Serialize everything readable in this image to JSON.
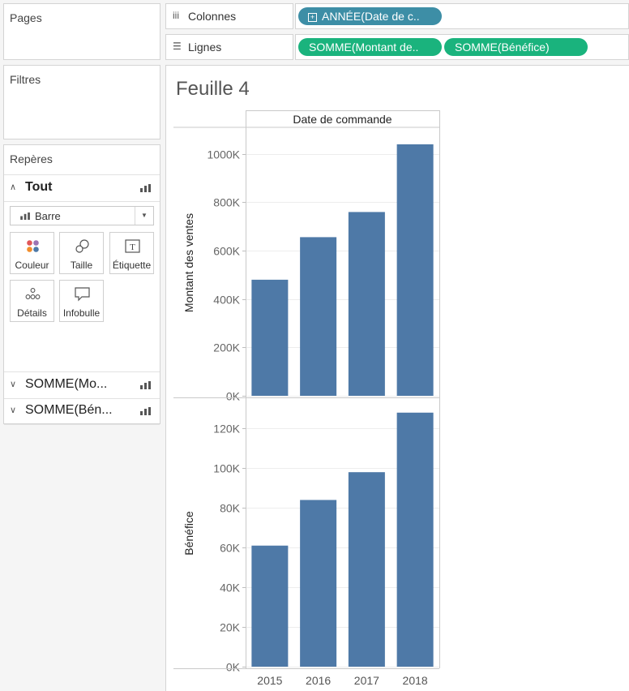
{
  "panels": {
    "pages": {
      "title": "Pages"
    },
    "filters": {
      "title": "Filtres"
    },
    "marks": {
      "title": "Repères",
      "all_label": "Tout",
      "mark_type": "Barre",
      "buttons": [
        "Couleur",
        "Taille",
        "Étiquette",
        "Détails",
        "Infobulle"
      ],
      "measure_rows": [
        "SOMME(Mo...",
        "SOMME(Bén..."
      ]
    }
  },
  "shelves": {
    "columns": {
      "label": "Colonnes",
      "pills": [
        "ANNÉE(Date de c.."
      ]
    },
    "rows": {
      "label": "Lignes",
      "pills": [
        "SOMME(Montant de..",
        "SOMME(Bénéfice)"
      ]
    }
  },
  "sheet": {
    "title": "Feuille 4"
  },
  "colors": {
    "bar": "#4e79a7",
    "pill_dimension": "#3d8ea6",
    "pill_measure": "#1ab37d"
  },
  "chart_data": {
    "type": "bar",
    "column_header": "Date de commande",
    "categories": [
      "2015",
      "2016",
      "2017",
      "2018"
    ],
    "panes": [
      {
        "ylabel": "Montant des ventes",
        "ylim": [
          0,
          1080000
        ],
        "ticks": [
          0,
          200000,
          400000,
          600000,
          800000,
          1000000
        ],
        "tick_labels": [
          "0K",
          "200K",
          "400K",
          "600K",
          "800K",
          "1000K"
        ],
        "values": [
          480000,
          656000,
          760000,
          1040000
        ]
      },
      {
        "ylabel": "Bénéfice",
        "ylim": [
          0,
          132000
        ],
        "ticks": [
          0,
          20000,
          40000,
          60000,
          80000,
          100000,
          120000
        ],
        "tick_labels": [
          "0K",
          "20K",
          "40K",
          "60K",
          "80K",
          "100K",
          "120K"
        ],
        "values": [
          61000,
          84000,
          98000,
          128000
        ]
      }
    ],
    "grid": true,
    "legend": "none"
  }
}
